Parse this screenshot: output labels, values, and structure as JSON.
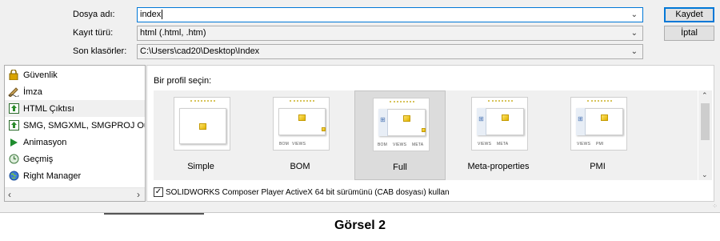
{
  "fields": {
    "filename": {
      "label": "Dosya adı:",
      "value": "index"
    },
    "filetype": {
      "label": "Kayıt türü:",
      "value": "html (.html, .htm)"
    },
    "recent": {
      "label": "Son klasörler:",
      "value": "C:\\Users\\cad20\\Desktop\\Index"
    }
  },
  "buttons": {
    "save": "Kaydet",
    "cancel": "İptal"
  },
  "sidebar": {
    "items": [
      {
        "label": "Güvenlik",
        "icon": "lock-icon"
      },
      {
        "label": "İmza",
        "icon": "signature-icon"
      },
      {
        "label": "HTML Çıktısı",
        "icon": "export-arrow-icon"
      },
      {
        "label": "SMG, SMGXML, SMGPROJ Outpu",
        "icon": "export-arrow-icon"
      },
      {
        "label": "Animasyon",
        "icon": "play-icon"
      },
      {
        "label": "Geçmiş",
        "icon": "history-icon"
      },
      {
        "label": "Right Manager",
        "icon": "globe-icon"
      }
    ]
  },
  "main": {
    "profile_label": "Bir profil seçin:",
    "profiles": [
      {
        "name": "Simple",
        "tags": []
      },
      {
        "name": "BOM",
        "tags": [
          "BOM",
          "VIEWS"
        ]
      },
      {
        "name": "Full",
        "tags": [
          "BOM",
          "VIEWS",
          "META"
        ]
      },
      {
        "name": "Meta-properties",
        "tags": [
          "VIEWS",
          "META"
        ]
      },
      {
        "name": "PMI",
        "tags": [
          "VIEWS",
          "PMI"
        ]
      }
    ],
    "selected_profile": "Full",
    "checkbox_label": "SOLIDWORKS Composer Player ActiveX 64 bit sürümünü (CAB dosyası) kullan",
    "checkbox_checked": true
  },
  "caption": "Görsel 2",
  "colors": {
    "focus_border": "#0078d7",
    "cube": "#f2c200",
    "selected_tile": "#dcdcdc"
  }
}
